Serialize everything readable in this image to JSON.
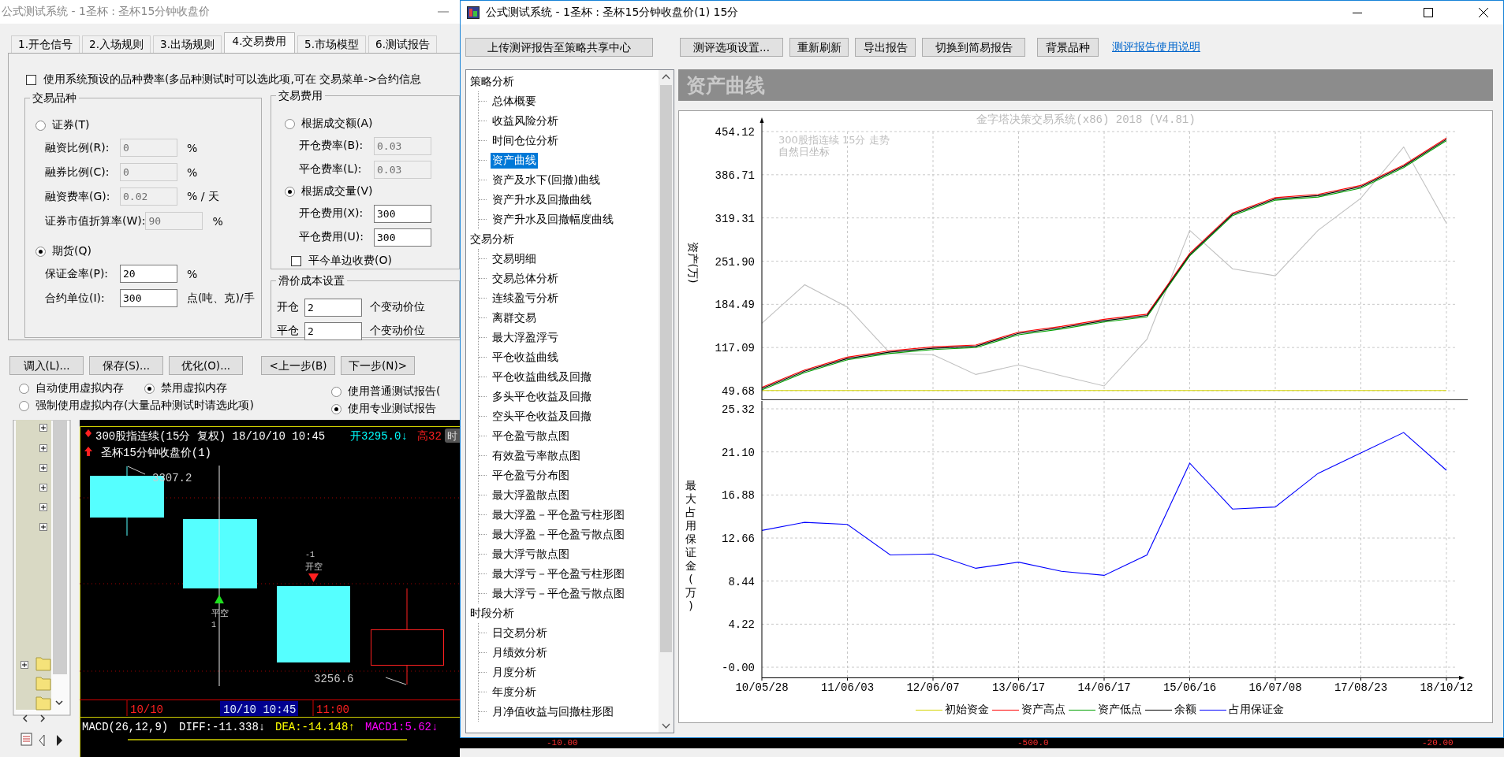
{
  "left_window": {
    "title": "公式测试系统 - 1圣杯 : 圣杯15分钟收盘价",
    "tabs": [
      {
        "label": "1.开仓信号",
        "selected": false
      },
      {
        "label": "2.入场规则",
        "selected": false
      },
      {
        "label": "3.出场规则",
        "selected": false
      },
      {
        "label": "4.交易费用",
        "selected": true
      },
      {
        "label": "5.市场模型",
        "selected": false
      },
      {
        "label": "6.测试报告",
        "selected": false
      }
    ],
    "system_rates": {
      "label": "使用系统预设的品种费率(多品种测试时可以选此项,可在 交易菜单->合约信息",
      "checked": false
    },
    "instrument_group": {
      "title": "交易品种",
      "options": [
        {
          "label": "证券(T)",
          "selected": false,
          "fields": [
            {
              "label": "融资比例(R):",
              "value": "0",
              "unit": "%",
              "disabled": true
            },
            {
              "label": "融券比例(C):",
              "value": "0",
              "unit": "%",
              "disabled": true
            },
            {
              "label": "融资费率(G):",
              "value": "0.02",
              "unit": "% / 天",
              "disabled": true
            },
            {
              "label": "证券市值折算率(W):",
              "value": "90",
              "unit": "%",
              "disabled": true
            }
          ]
        },
        {
          "label": "期货(Q)",
          "selected": true,
          "fields": [
            {
              "label": "保证金率(P):",
              "value": "20",
              "unit": "%",
              "disabled": false
            },
            {
              "label": "合约单位(I):",
              "value": "300",
              "unit": "点(吨、克)/手",
              "disabled": false
            }
          ]
        }
      ]
    },
    "fee_group": {
      "title": "交易费用",
      "options": [
        {
          "label": "根据成交额(A)",
          "selected": false,
          "fields": [
            {
              "label": "开仓费率(B):",
              "value": "0.03",
              "disabled": true
            },
            {
              "label": "平仓费率(L):",
              "value": "0.03",
              "disabled": true
            }
          ]
        },
        {
          "label": "根据成交量(V)",
          "selected": true,
          "fields": [
            {
              "label": "开仓费用(X):",
              "value": "300",
              "disabled": false
            },
            {
              "label": "平仓费用(U):",
              "value": "300",
              "disabled": false
            }
          ]
        }
      ],
      "one_side": {
        "label": "平今单边收费(O)",
        "checked": false
      }
    },
    "slippage_group": {
      "title": "滑价成本设置",
      "rows": [
        {
          "label": "开仓",
          "value": "2",
          "unit": "个变动价位"
        },
        {
          "label": "平仓",
          "value": "2",
          "unit": "个变动价位"
        }
      ]
    },
    "buttons": [
      "调入(L)...",
      "保存(S)...",
      "优化(O)...",
      "<上一步(B)",
      "下一步(N)>"
    ],
    "memory_options": [
      {
        "label": "自动使用虚拟内存",
        "selected": false
      },
      {
        "label": "禁用虚拟内存",
        "selected": true
      },
      {
        "label": "强制使用虚拟内存(大量品种测试时请选此项)",
        "selected": false
      }
    ],
    "report_options": [
      {
        "label": "使用普通测试报告(",
        "selected": false
      },
      {
        "label": "使用专业测试报告",
        "selected": true
      }
    ],
    "kline": {
      "header": "300股指连续(15分 复权) 18/10/10 10:45",
      "open": "开3295.0↓",
      "high": "高32",
      "period_button": "时",
      "formula": "圣杯15分钟收盘价(1)",
      "high_label": "3307.2",
      "low_label": "3256.6",
      "signals": [
        {
          "kind": "buy",
          "label": "平空",
          "qty": "1"
        },
        {
          "kind": "sell",
          "label": "开空",
          "qty": "-1"
        }
      ],
      "time_labels": [
        {
          "text": "10/10",
          "selected": false
        },
        {
          "text": "10/10 10:45",
          "selected": true
        },
        {
          "text": "11:00",
          "selected": false
        }
      ],
      "indicators": [
        {
          "text": "MACD(26,12,9)",
          "color": "#ffffff"
        },
        {
          "text": "DIFF:-11.338↓",
          "color": "#ffffff"
        },
        {
          "text": "DEA:-14.148↑",
          "color": "#ffff00"
        },
        {
          "text": "MACD1:5.62↓",
          "color": "#ff00ff"
        }
      ]
    }
  },
  "right_window": {
    "title": "公式测试系统 - 1圣杯 : 圣杯15分钟收盘价(1) 15分",
    "upload_button": "上传测评报告至策略共享中心",
    "toolbar": [
      "测评选项设置...",
      "重新刷新",
      "导出报告",
      "切换到简易报告",
      "背景品种"
    ],
    "help_link": "测评报告使用说明",
    "tree": [
      {
        "label": "策略分析",
        "selected": false,
        "children": [
          {
            "label": "总体概要",
            "selected": false
          },
          {
            "label": "收益风险分析",
            "selected": false
          },
          {
            "label": "时间仓位分析",
            "selected": false
          },
          {
            "label": "资产曲线",
            "selected": true
          },
          {
            "label": "资产及水下(回撤)曲线",
            "selected": false
          },
          {
            "label": "资产升水及回撤曲线",
            "selected": false
          },
          {
            "label": "资产升水及回撤幅度曲线",
            "selected": false
          }
        ]
      },
      {
        "label": "交易分析",
        "selected": false,
        "children": [
          {
            "label": "交易明细",
            "selected": false
          },
          {
            "label": "交易总体分析",
            "selected": false
          },
          {
            "label": "连续盈亏分析",
            "selected": false
          },
          {
            "label": "离群交易",
            "selected": false
          },
          {
            "label": "最大浮盈浮亏",
            "selected": false
          },
          {
            "label": "平仓收益曲线",
            "selected": false
          },
          {
            "label": "平仓收益曲线及回撤",
            "selected": false
          },
          {
            "label": "多头平仓收益及回撤",
            "selected": false
          },
          {
            "label": "空头平仓收益及回撤",
            "selected": false
          },
          {
            "label": "平仓盈亏散点图",
            "selected": false
          },
          {
            "label": "有效盈亏率散点图",
            "selected": false
          },
          {
            "label": "平仓盈亏分布图",
            "selected": false
          },
          {
            "label": "最大浮盈散点图",
            "selected": false
          },
          {
            "label": "最大浮盈－平仓盈亏柱形图",
            "selected": false
          },
          {
            "label": "最大浮盈－平仓盈亏散点图",
            "selected": false
          },
          {
            "label": "最大浮亏散点图",
            "selected": false
          },
          {
            "label": "最大浮亏－平仓盈亏柱形图",
            "selected": false
          },
          {
            "label": "最大浮亏－平仓盈亏散点图",
            "selected": false
          }
        ]
      },
      {
        "label": "时段分析",
        "selected": false,
        "children": [
          {
            "label": "日交易分析",
            "selected": false
          },
          {
            "label": "月绩效分析",
            "selected": false
          },
          {
            "label": "月度分析",
            "selected": false
          },
          {
            "label": "年度分析",
            "selected": false
          },
          {
            "label": "月净值收益与回撤柱形图",
            "selected": false
          }
        ]
      }
    ],
    "section_title": "资产曲线",
    "asset_chart": {
      "chart_data": {
        "type": "line",
        "title": "金字塔决策交易系统(x86) 2018 (V4.81)",
        "ylabel": "资产(万)",
        "grid": true,
        "categories": [
          null,
          null,
          null,
          null,
          null,
          null,
          null,
          null,
          null,
          null,
          null,
          null,
          null,
          null,
          null,
          null,
          null
        ],
        "ylim": [
          49.68,
          454.12
        ],
        "yticks": [
          {
            "value": 49.68,
            "label": "49.68"
          },
          {
            "value": 117.09,
            "label": "117.09"
          },
          {
            "value": 184.49,
            "label": "184.49"
          },
          {
            "value": 251.9,
            "label": "251.90"
          },
          {
            "value": 319.31,
            "label": "319.31"
          },
          {
            "value": 386.71,
            "label": "386.71"
          },
          {
            "value": 454.12,
            "label": "454.12"
          }
        ],
        "annotations": [
          {
            "text": "自然日坐标"
          }
        ],
        "series": [
          {
            "name": "300股指连续 15分 走势",
            "color": "#c0c0c0",
            "values": [
              155,
              215,
              180,
              108,
              106,
              75,
              90,
              73,
              57,
              130,
              300,
              240,
              229,
              300,
              350,
              430,
              311
            ]
          },
          {
            "name": "初始资金",
            "color": "#d4d400",
            "values": [
              50,
              50,
              50,
              50,
              50,
              50,
              50,
              50,
              50,
              50,
              50,
              50,
              50,
              50,
              50,
              50,
              50
            ]
          },
          {
            "name": "资产高点",
            "color": "#ff0000",
            "values": [
              55,
              82,
              102,
              112,
              118,
              121,
              141,
              150,
              161,
              169,
              264,
              327,
              351,
              356,
              370,
              402,
              444
            ]
          },
          {
            "name": "资产低点",
            "color": "#00a000",
            "values": [
              51,
              78,
              98,
              108,
              114,
              117,
              137,
              146,
              157,
              165,
              260,
              323,
              347,
              352,
              366,
              398,
              440
            ]
          },
          {
            "name": "余额",
            "color": "#000000",
            "values": [
              53,
              80,
              100,
              110,
              116,
              119,
              139,
              148,
              159,
              167,
              262,
              325,
              349,
              354,
              368,
              400,
              442
            ]
          }
        ]
      }
    },
    "margin_chart": {
      "chart_data": {
        "type": "line",
        "ylabel": "最大占用保证金(万)",
        "grid": true,
        "categories": [
          "10/05/28",
          null,
          "11/06/03",
          null,
          "12/06/07",
          null,
          "13/06/17",
          null,
          "14/06/17",
          null,
          "15/06/16",
          null,
          "16/07/08",
          null,
          "17/08/23",
          null,
          "18/10/12"
        ],
        "ylim": [
          -1.0,
          25.32
        ],
        "yticks": [
          {
            "value": 0,
            "label": "-0.00"
          },
          {
            "value": 4.22,
            "label": "4.22"
          },
          {
            "value": 8.44,
            "label": "8.44"
          },
          {
            "value": 12.66,
            "label": "12.66"
          },
          {
            "value": 16.88,
            "label": "16.88"
          },
          {
            "value": 21.1,
            "label": "21.10"
          },
          {
            "value": 25.32,
            "label": "25.32"
          }
        ],
        "series": [
          {
            "name": "占用保证金",
            "color": "#0000ff",
            "values": [
              13.4,
              14.2,
              14.0,
              11.0,
              11.1,
              9.7,
              10.3,
              9.4,
              9.0,
              11.0,
              20.0,
              15.5,
              15.7,
              19.0,
              21.0,
              23.0,
              19.3
            ]
          }
        ]
      }
    }
  },
  "bottom_strip": {
    "readings": [
      "-10.00",
      "-500.0",
      "-20.00"
    ]
  }
}
